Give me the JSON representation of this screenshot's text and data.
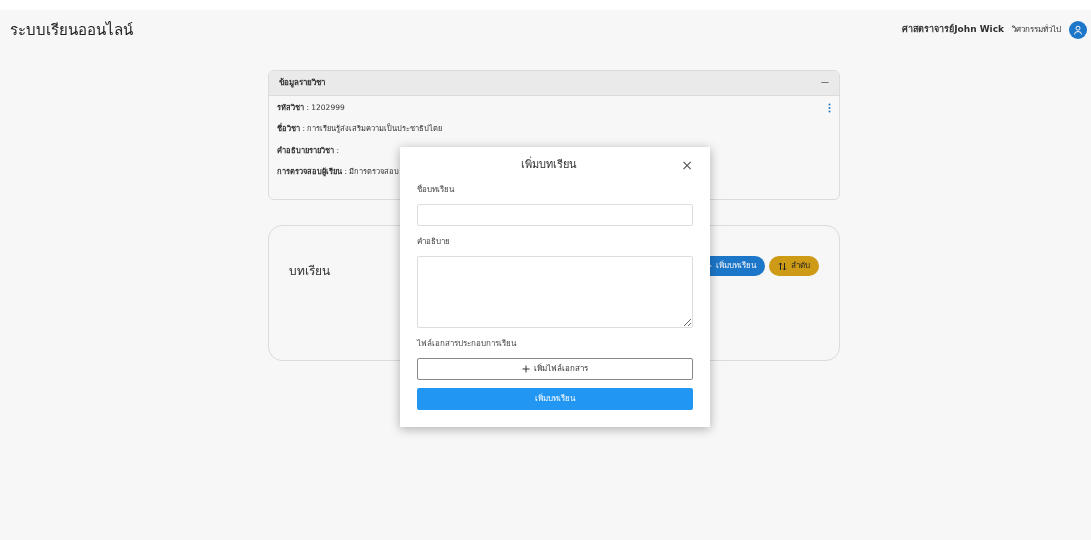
{
  "header": {
    "title": "ระบบเรียนออนไลน์",
    "user_name": "ศาสตราจารย์John Wick",
    "department": "วิศวกรรมทั่วไป"
  },
  "course_card": {
    "title": "ข้อมูลรายวิชา",
    "collapse": "—",
    "fields": [
      {
        "text": "**รหัสวิชา** : 1202999"
      },
      {
        "text": "**ชื่อวิชา** : การเรียนรู้ส่งเสริมความเป็นประชาธิปไตย"
      },
      {
        "text": "**คำอธิบายรายวิชา** :"
      },
      {
        "text": "**การตรวจสอบผู้เรียน** : มีการตรวจสอบ"
      }
    ]
  },
  "lessons_card": {
    "title": "บทเรียน",
    "buttons": [
      {
        "label": "เพิ่มบทเรียน",
        "kind": "add"
      },
      {
        "label": "ลำดับ",
        "kind": "sort"
      }
    ]
  },
  "modal": {
    "title": "เพิ่มบทเรียน",
    "close": "×",
    "fields": [
      {
        "label": "ชื่อบทเรียน",
        "kind": "input"
      },
      {
        "label": "คำอธิบาย",
        "kind": "textarea"
      }
    ],
    "file_label": "ไฟล์เอกสารประกอบการเรียน",
    "file_button": "เพิ่มไฟล์เอกสาร",
    "submit": "เพิ่มบทเรียน"
  }
}
